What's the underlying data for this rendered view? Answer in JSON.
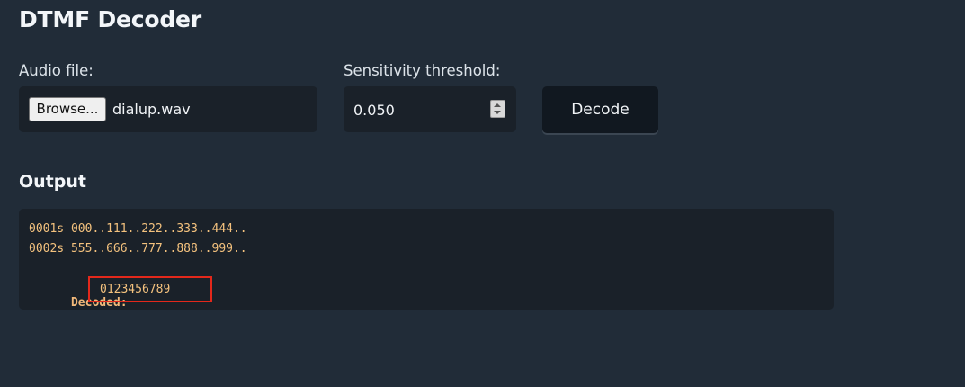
{
  "header": {
    "title": "DTMF Decoder"
  },
  "form": {
    "audio_file_label": "Audio file:",
    "browse_label": "Browse...",
    "file_name": "dialup.wav",
    "threshold_label": "Sensitivity threshold:",
    "threshold_value": "0.050",
    "decode_label": "Decode"
  },
  "output": {
    "heading": "Output",
    "lines": [
      "0001s 000..111..222..333..444..",
      "0002s 555..666..777..888..999.."
    ],
    "decoded_label": "Decoded:",
    "decoded_value": "0123456789"
  },
  "colors": {
    "background": "#212c38",
    "panel": "#1a2129",
    "output_text": "#f4c27e",
    "highlight": "#e3281b"
  },
  "icons": {
    "spinner": "number-spinner-icon"
  }
}
